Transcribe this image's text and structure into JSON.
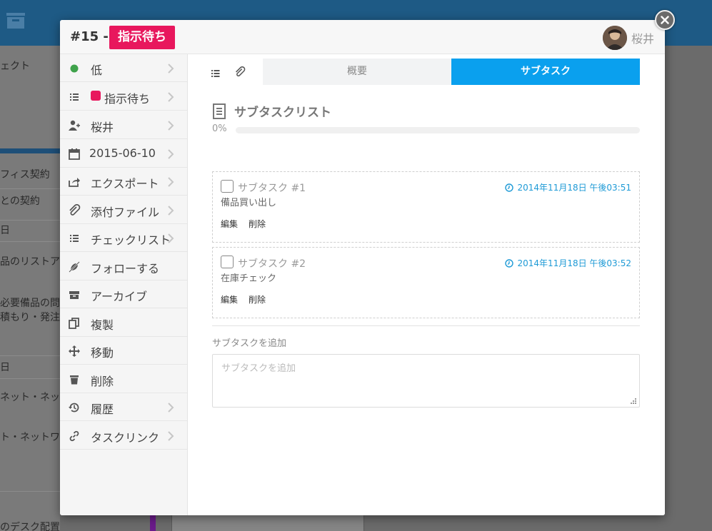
{
  "background": {
    "rows": [
      "ェクト",
      "フィス契約",
      "との契約",
      "日",
      "品のリストア",
      "必要備品の問",
      "積もり・発注",
      "日",
      "ネット・ネッ",
      "ト・ネットワー",
      "のデスク配置設計"
    ]
  },
  "modal": {
    "task_number": "#15 -",
    "status_label": "指示待ち",
    "owner_name": "桜井"
  },
  "sidebar": {
    "items": [
      {
        "label": "低",
        "icon": "priority-dot-icon"
      },
      {
        "label": "指示待ち",
        "icon": "list-icon"
      },
      {
        "label": "桜井",
        "icon": "user-add-icon"
      },
      {
        "label": "2015-06-10",
        "icon": "calendar-icon"
      },
      {
        "label": "エクスポート",
        "icon": "export-icon"
      },
      {
        "label": "添付ファイル",
        "icon": "paperclip-icon"
      },
      {
        "label": "チェックリスト",
        "icon": "checklist-icon"
      },
      {
        "label": "フォローする",
        "icon": "follow-icon"
      },
      {
        "label": "アーカイブ",
        "icon": "archive-icon"
      },
      {
        "label": "複製",
        "icon": "duplicate-icon"
      },
      {
        "label": "移動",
        "icon": "move-icon"
      },
      {
        "label": "削除",
        "icon": "trash-icon"
      },
      {
        "label": "履歴",
        "icon": "history-icon"
      },
      {
        "label": "タスクリンク",
        "icon": "link-icon"
      }
    ]
  },
  "tabs": {
    "overview": "概要",
    "subtask": "サブタスク",
    "active": "subtask"
  },
  "subtask_list": {
    "title": "サブタスクリスト",
    "progress_label": "0%",
    "progress_value": 0,
    "items": [
      {
        "name": "サブタスク #1",
        "date": "2014年11月18日 午後03:51",
        "description": "備品買い出し",
        "edit": "編集",
        "delete": "削除"
      },
      {
        "name": "サブタスク #2",
        "date": "2014年11月18日 午後03:52",
        "description": "在庫チェック",
        "edit": "編集",
        "delete": "削除"
      }
    ]
  },
  "add_subtask": {
    "label": "サブタスクを追加",
    "placeholder": "サブタスクを追加",
    "value": ""
  },
  "colors": {
    "status_pink": "#e8175d",
    "accent_blue": "#0aa0ee",
    "priority_green": "#3fa24b",
    "date_blue": "#1e9ad6"
  }
}
